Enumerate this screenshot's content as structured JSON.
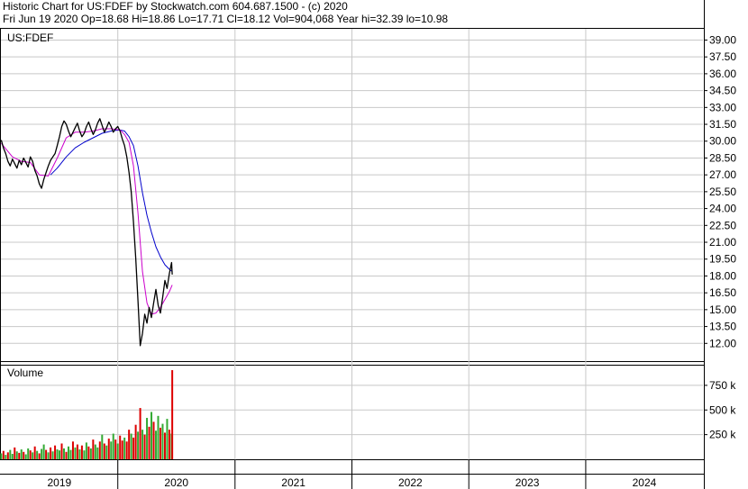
{
  "header": {
    "title": "Historic Chart for US:FDEF by Stockwatch.com 604.687.1500 - (c) 2020",
    "quote": "Fri Jun 19 2020   Op=18.68  Hi=18.86  Lo=17.71  Cl=18.12  Vol=904,068   Year hi=32.39  lo=10.98"
  },
  "colors": {
    "price": "#000000",
    "ma_short": "#cc00cc",
    "ma_long": "#0000cc",
    "volume_up": "#33aa33",
    "volume_down": "#dd0000",
    "grid": "#c8c8c8"
  },
  "chart_data": [
    {
      "type": "line",
      "title": "US:FDEF",
      "ylim": [
        10.5,
        40.0
      ],
      "yticks": [
        "39.00",
        "37.50",
        "36.00",
        "34.50",
        "33.00",
        "31.50",
        "30.00",
        "28.50",
        "27.00",
        "25.50",
        "24.00",
        "22.50",
        "21.00",
        "19.50",
        "18.00",
        "16.50",
        "15.00",
        "13.50",
        "12.00"
      ],
      "xlim": [
        "2019-01-01",
        "2025-01-01"
      ],
      "x_labels": [
        "2019",
        "2020",
        "2021",
        "2022",
        "2023",
        "2024"
      ],
      "series": [
        {
          "key": "price",
          "x": [
            "2019-01-02",
            "2019-01-09",
            "2019-01-16",
            "2019-01-23",
            "2019-01-30",
            "2019-02-06",
            "2019-02-13",
            "2019-02-20",
            "2019-02-27",
            "2019-03-06",
            "2019-03-13",
            "2019-03-20",
            "2019-03-27",
            "2019-04-03",
            "2019-04-10",
            "2019-04-17",
            "2019-04-24",
            "2019-05-01",
            "2019-05-08",
            "2019-05-15",
            "2019-05-22",
            "2019-05-29",
            "2019-06-05",
            "2019-06-12",
            "2019-06-19",
            "2019-06-26",
            "2019-07-03",
            "2019-07-10",
            "2019-07-17",
            "2019-07-24",
            "2019-07-31",
            "2019-08-07",
            "2019-08-14",
            "2019-08-21",
            "2019-08-28",
            "2019-09-04",
            "2019-09-11",
            "2019-09-18",
            "2019-09-25",
            "2019-10-02",
            "2019-10-09",
            "2019-10-16",
            "2019-10-23",
            "2019-10-30",
            "2019-11-06",
            "2019-11-13",
            "2019-11-20",
            "2019-11-27",
            "2019-12-04",
            "2019-12-11",
            "2019-12-18",
            "2019-12-25",
            "2020-01-01",
            "2020-01-08",
            "2020-01-15",
            "2020-01-22",
            "2020-01-29",
            "2020-02-05",
            "2020-02-12",
            "2020-02-19",
            "2020-02-26",
            "2020-03-04",
            "2020-03-11",
            "2020-03-18",
            "2020-03-25",
            "2020-04-01",
            "2020-04-08",
            "2020-04-15",
            "2020-04-22",
            "2020-04-29",
            "2020-05-06",
            "2020-05-13",
            "2020-05-20",
            "2020-05-27",
            "2020-06-03",
            "2020-06-10",
            "2020-06-17",
            "2020-06-19"
          ],
          "values": [
            30.1,
            29.4,
            28.9,
            28.2,
            27.8,
            28.4,
            28.0,
            27.6,
            28.3,
            27.9,
            28.5,
            28.1,
            27.7,
            28.6,
            28.2,
            27.4,
            26.9,
            26.2,
            25.8,
            26.6,
            27.2,
            27.8,
            28.3,
            28.6,
            28.9,
            29.6,
            30.4,
            31.3,
            31.8,
            31.5,
            30.9,
            30.4,
            30.8,
            31.2,
            31.6,
            30.9,
            30.4,
            30.7,
            31.3,
            31.7,
            31.1,
            30.6,
            31.0,
            31.6,
            32.0,
            31.4,
            30.8,
            31.2,
            31.7,
            31.3,
            30.8,
            31.1,
            31.3,
            30.9,
            30.2,
            29.6,
            28.6,
            27.2,
            25.5,
            22.8,
            19.6,
            15.8,
            11.8,
            12.9,
            14.6,
            13.8,
            15.2,
            14.3,
            15.6,
            16.8,
            15.4,
            14.7,
            16.1,
            17.6,
            16.9,
            18.2,
            19.2,
            18.12
          ]
        },
        {
          "key": "ma_short",
          "x": [
            "2019-01-02",
            "2019-02-06",
            "2019-03-06",
            "2019-04-03",
            "2019-05-01",
            "2019-05-29",
            "2019-06-26",
            "2019-07-24",
            "2019-08-21",
            "2019-09-18",
            "2019-10-16",
            "2019-11-13",
            "2019-12-11",
            "2020-01-08",
            "2020-01-22",
            "2020-02-05",
            "2020-02-19",
            "2020-03-04",
            "2020-03-18",
            "2020-04-01",
            "2020-04-15",
            "2020-04-29",
            "2020-05-13",
            "2020-05-27",
            "2020-06-10",
            "2020-06-19"
          ],
          "values": [
            29.8,
            28.6,
            28.2,
            28.1,
            27.0,
            26.9,
            28.5,
            30.3,
            30.8,
            30.8,
            30.9,
            31.1,
            31.1,
            31.0,
            30.6,
            29.9,
            27.8,
            23.6,
            18.4,
            15.6,
            14.6,
            14.7,
            15.2,
            15.9,
            16.6,
            17.2
          ]
        },
        {
          "key": "ma_long",
          "x": [
            "2019-06-05",
            "2019-06-26",
            "2019-07-24",
            "2019-08-21",
            "2019-09-18",
            "2019-10-16",
            "2019-11-13",
            "2019-12-11",
            "2020-01-08",
            "2020-01-22",
            "2020-02-05",
            "2020-02-19",
            "2020-03-04",
            "2020-03-18",
            "2020-04-01",
            "2020-04-15",
            "2020-04-29",
            "2020-05-13",
            "2020-05-27",
            "2020-06-10",
            "2020-06-19"
          ],
          "values": [
            27.0,
            27.6,
            28.6,
            29.4,
            29.9,
            30.3,
            30.7,
            30.9,
            31.0,
            30.9,
            30.4,
            29.6,
            27.8,
            25.4,
            23.4,
            21.9,
            20.6,
            19.7,
            19.0,
            18.6,
            18.4
          ]
        }
      ]
    },
    {
      "type": "bar",
      "title": "Volume",
      "ylim": [
        0,
        950000
      ],
      "yticks": [
        "750 k",
        "500 k",
        "250 k"
      ],
      "x": [
        "2019-01-02",
        "2019-01-09",
        "2019-01-16",
        "2019-01-23",
        "2019-01-30",
        "2019-02-06",
        "2019-02-13",
        "2019-02-20",
        "2019-02-27",
        "2019-03-06",
        "2019-03-13",
        "2019-03-20",
        "2019-03-27",
        "2019-04-03",
        "2019-04-10",
        "2019-04-17",
        "2019-04-24",
        "2019-05-01",
        "2019-05-08",
        "2019-05-15",
        "2019-05-22",
        "2019-05-29",
        "2019-06-05",
        "2019-06-12",
        "2019-06-19",
        "2019-06-26",
        "2019-07-03",
        "2019-07-10",
        "2019-07-17",
        "2019-07-24",
        "2019-07-31",
        "2019-08-07",
        "2019-08-14",
        "2019-08-21",
        "2019-08-28",
        "2019-09-04",
        "2019-09-11",
        "2019-09-18",
        "2019-09-25",
        "2019-10-02",
        "2019-10-09",
        "2019-10-16",
        "2019-10-23",
        "2019-10-30",
        "2019-11-06",
        "2019-11-13",
        "2019-11-20",
        "2019-11-27",
        "2019-12-04",
        "2019-12-11",
        "2019-12-18",
        "2019-12-25",
        "2020-01-01",
        "2020-01-08",
        "2020-01-15",
        "2020-01-22",
        "2020-01-29",
        "2020-02-05",
        "2020-02-12",
        "2020-02-19",
        "2020-02-26",
        "2020-03-04",
        "2020-03-11",
        "2020-03-18",
        "2020-03-25",
        "2020-04-01",
        "2020-04-08",
        "2020-04-15",
        "2020-04-22",
        "2020-04-29",
        "2020-05-06",
        "2020-05-13",
        "2020-05-20",
        "2020-05-27",
        "2020-06-03",
        "2020-06-10",
        "2020-06-17",
        "2020-06-19"
      ],
      "values": [
        60000,
        85000,
        45000,
        70000,
        95000,
        55000,
        120000,
        80000,
        65000,
        100000,
        75000,
        50000,
        110000,
        90000,
        70000,
        130000,
        85000,
        60000,
        105000,
        150000,
        95000,
        70000,
        120000,
        80000,
        140000,
        100000,
        90000,
        160000,
        110000,
        75000,
        130000,
        95000,
        180000,
        120000,
        150000,
        100000,
        140000,
        90000,
        170000,
        130000,
        110000,
        200000,
        150000,
        120000,
        180000,
        250000,
        160000,
        140000,
        210000,
        180000,
        260000,
        200000,
        160000,
        240000,
        190000,
        220000,
        180000,
        300000,
        260000,
        220000,
        350000,
        280000,
        520000,
        300000,
        250000,
        420000,
        330000,
        480000,
        380000,
        290000,
        440000,
        320000,
        360000,
        270000,
        410000,
        300000,
        260000,
        904068
      ],
      "up": [
        1,
        0,
        1,
        0,
        1,
        1,
        0,
        1,
        0,
        1,
        0,
        1,
        1,
        0,
        1,
        0,
        1,
        0,
        1,
        1,
        0,
        1,
        0,
        1,
        0,
        1,
        1,
        0,
        1,
        0,
        1,
        1,
        0,
        1,
        0,
        1,
        0,
        1,
        1,
        0,
        1,
        0,
        1,
        1,
        0,
        1,
        0,
        1,
        0,
        1,
        1,
        0,
        1,
        0,
        0,
        1,
        0,
        0,
        1,
        0,
        0,
        1,
        0,
        1,
        0,
        1,
        0,
        1,
        0,
        1,
        1,
        0,
        1,
        0,
        1,
        0,
        1,
        0
      ]
    }
  ]
}
